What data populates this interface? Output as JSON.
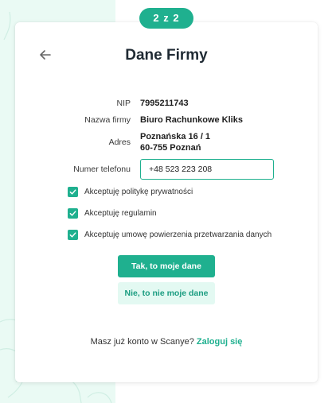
{
  "step": {
    "label": "2 z 2"
  },
  "page": {
    "title": "Dane Firmy"
  },
  "company": {
    "nip_label": "NIP",
    "nip_value": "7995211743",
    "name_label": "Nazwa firmy",
    "name_value": "Biuro Rachunkowe Kliks",
    "address_label": "Adres",
    "address_line1": "Poznańska 16 / 1",
    "address_line2": "60-755 Poznań",
    "phone_label": "Numer telefonu",
    "phone_value": "+48 523 223 208"
  },
  "consents": [
    {
      "label": "Akceptuję politykę prywatności",
      "checked": true
    },
    {
      "label": "Akceptuję regulamin",
      "checked": true
    },
    {
      "label": "Akceptuję umowę powierzenia przetwarzania danych",
      "checked": true
    }
  ],
  "actions": {
    "confirm_label": "Tak, to moje dane",
    "deny_label": "Nie, to nie moje dane"
  },
  "footer": {
    "text": "Masz już konto w Scanye?",
    "login_label": "Zaloguj się"
  },
  "colors": {
    "accent": "#1fb08f",
    "accent_light": "#e3f9f2",
    "background_tint": "#eafaf4"
  }
}
